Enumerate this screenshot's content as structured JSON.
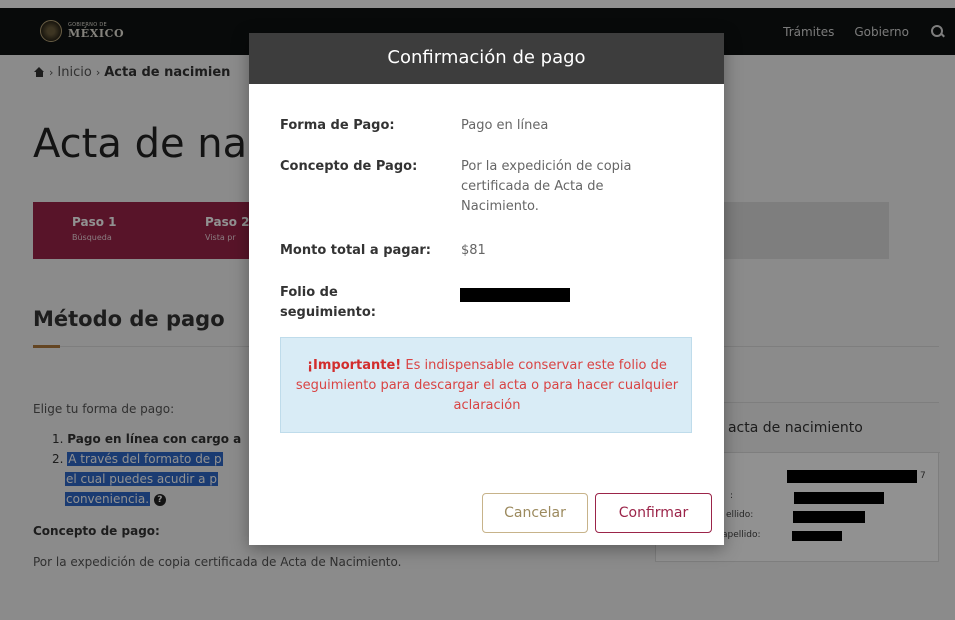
{
  "header": {
    "logo_small": "GOBIERNO DE",
    "logo_big": "MÉXICO",
    "links": [
      "Trámites",
      "Gobierno"
    ],
    "search_icon": "search-icon"
  },
  "breadcrumb": {
    "home_icon": "home-icon",
    "items": [
      "Inicio",
      "Acta de nacimien"
    ]
  },
  "page": {
    "title": "Acta de na",
    "steps": [
      {
        "label": "Paso 1",
        "sub": "Búsqueda"
      },
      {
        "label": "Paso 2",
        "sub": "Vista pr"
      }
    ],
    "section_title": "Método de pago",
    "choose_text": "Elige tu forma de pago:",
    "list": [
      {
        "num": "1.",
        "text": "Pago en línea con cargo a"
      },
      {
        "num": "2.",
        "lines": [
          "A través del formato de p",
          "el cual puedes acudir a p",
          "conveniencia."
        ]
      }
    ],
    "concept_label": "Concepto de pago:",
    "concept_text": "Por la expedición de copia certificada de Acta de Nacimiento."
  },
  "side_card": {
    "title": "el acta de nacimiento",
    "labels": [
      ":",
      "ellido:",
      "apellido:"
    ],
    "trailing": "7"
  },
  "modal": {
    "title": "Confirmación de pago",
    "rows": [
      {
        "label": "Forma de Pago:",
        "value": "Pago en línea"
      },
      {
        "label": "Concepto de Pago:",
        "value": "Por la expedición de copia certificada de Acta de Nacimiento."
      },
      {
        "label": "Monto total a pagar:",
        "value": "$81"
      },
      {
        "label": "Folio de seguimiento:",
        "value": ""
      }
    ],
    "alert": {
      "strong": "¡Importante!",
      "text": " Es indispensable conservar este folio de seguimiento para descargar el acta o para hacer cualquier aclaración"
    },
    "cancel_label": "Cancelar",
    "confirm_label": "Confirmar"
  },
  "colors": {
    "brand": "#9b2449",
    "navbar": "#0f1312",
    "modal_header": "#3d3d3d",
    "alert_bg": "#d9ecf6",
    "alert_text": "#d22d2d",
    "cancel_border": "#c7b38a"
  }
}
